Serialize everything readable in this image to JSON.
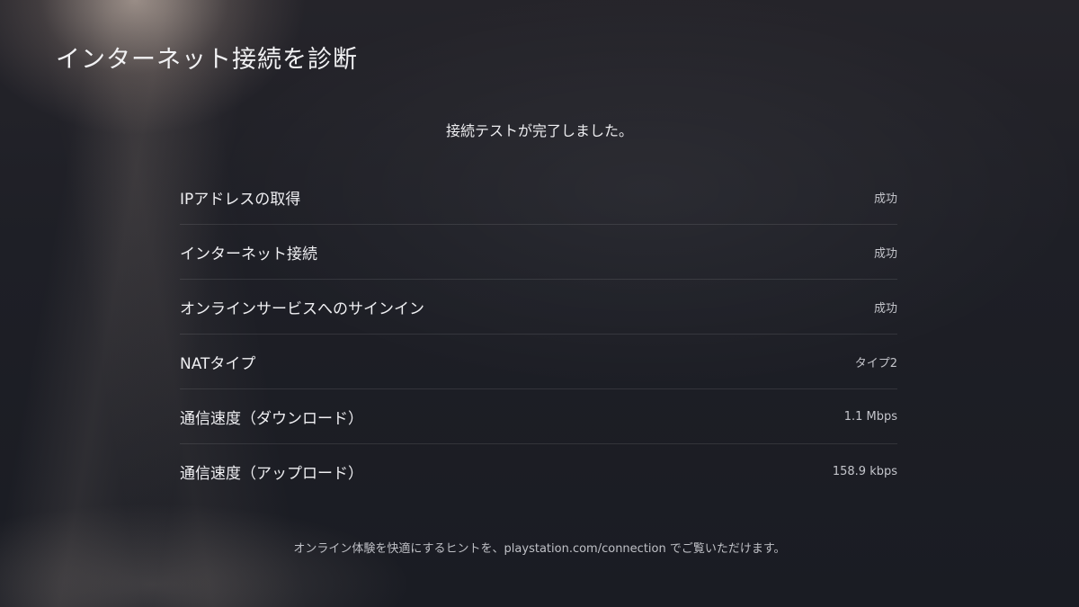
{
  "page": {
    "title": "インターネット接続を診断",
    "status_message": "接続テストが完了しました。",
    "hint": "オンライン体験を快適にするヒントを、playstation.com/connection でご覧いただけます。"
  },
  "results": [
    {
      "label": "IPアドレスの取得",
      "value": "成功"
    },
    {
      "label": "インターネット接続",
      "value": "成功"
    },
    {
      "label": "オンラインサービスへのサインイン",
      "value": "成功"
    },
    {
      "label": "NATタイプ",
      "value": "タイプ2"
    },
    {
      "label": "通信速度（ダウンロード）",
      "value": "1.1 Mbps"
    },
    {
      "label": "通信速度（アップロード）",
      "value": "158.9 kbps"
    }
  ]
}
